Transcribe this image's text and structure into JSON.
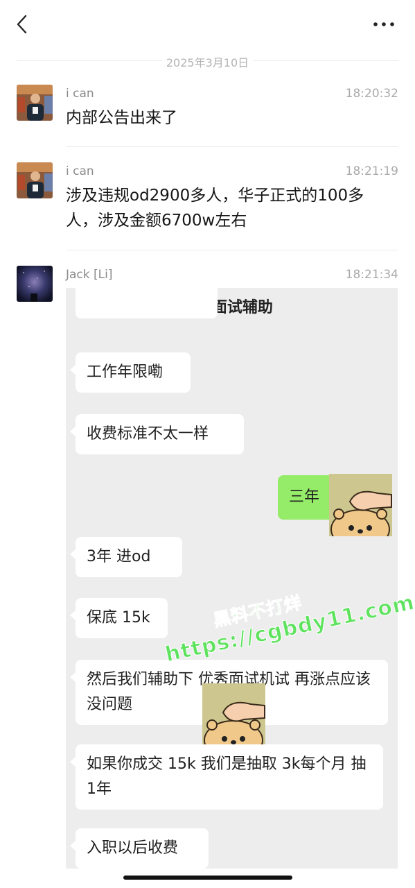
{
  "header": {
    "back_icon": "chevron-left-icon",
    "more_icon": "ellipsis-icon"
  },
  "date_separator": "2025年3月10日",
  "messages": [
    {
      "sender": "i can",
      "time": "18:20:32",
      "text": "内部公告出来了"
    },
    {
      "sender": "i can",
      "time": "18:21:19",
      "text": "涉及违规od2900多人，华子正式的100多人，涉及金额6700w左右"
    },
    {
      "sender": "Jack [Li]",
      "time": "18:21:34"
    }
  ],
  "screenshot": {
    "title": "od面试辅助",
    "bubbles": [
      "工作年限嘞",
      "收费标准不太一样",
      "3年  进od",
      "保底 15k",
      "然后我们辅助下 优秀面试机试  再涨点应该没问题",
      "如果你成交 15k   我们是抽取 3k每个月  抽 1年",
      "入职以后收费"
    ],
    "reply": "三年"
  },
  "watermark": {
    "line1": "黑料不打烊",
    "line2": "https://cgbdy11.com"
  },
  "colors": {
    "accent_green": "#95ec69",
    "watermark_green": "#5fe35f",
    "chat_bg": "#ededed"
  }
}
